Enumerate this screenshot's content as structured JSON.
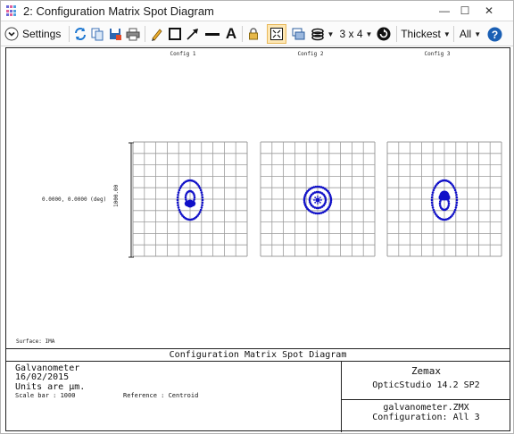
{
  "window": {
    "title": "2: Configuration Matrix Spot Diagram",
    "minimize_glyph": "—",
    "maximize_glyph": "☐",
    "close_glyph": "✕"
  },
  "toolbar": {
    "settings_label": "Settings",
    "layout_label": "3 x 4",
    "line_thickness_label": "Thickest",
    "show_label": "All",
    "text_tool_glyph": "A"
  },
  "plot": {
    "config_titles": [
      "Config 1",
      "Config 2",
      "Config 3"
    ],
    "field_label": "0.0000, 0.0000 (deg)",
    "scale_bar_label": "1000.00",
    "surface_label": "Surface: IMA",
    "spot_color": "#1010c8",
    "grid_color": "#9c9c9c"
  },
  "info_box": {
    "title": "Configuration Matrix Spot Diagram",
    "lens_name": "Galvanometer",
    "date": "16/02/2015",
    "units": "Units are µm.",
    "scale_bar": "Scale bar  : 1000",
    "reference": "Reference  : Centroid",
    "company": "Zemax",
    "product": "OpticStudio 14.2 SP2",
    "file_name": "galvanometer.ZMX",
    "configuration": "Configuration: All 3"
  }
}
